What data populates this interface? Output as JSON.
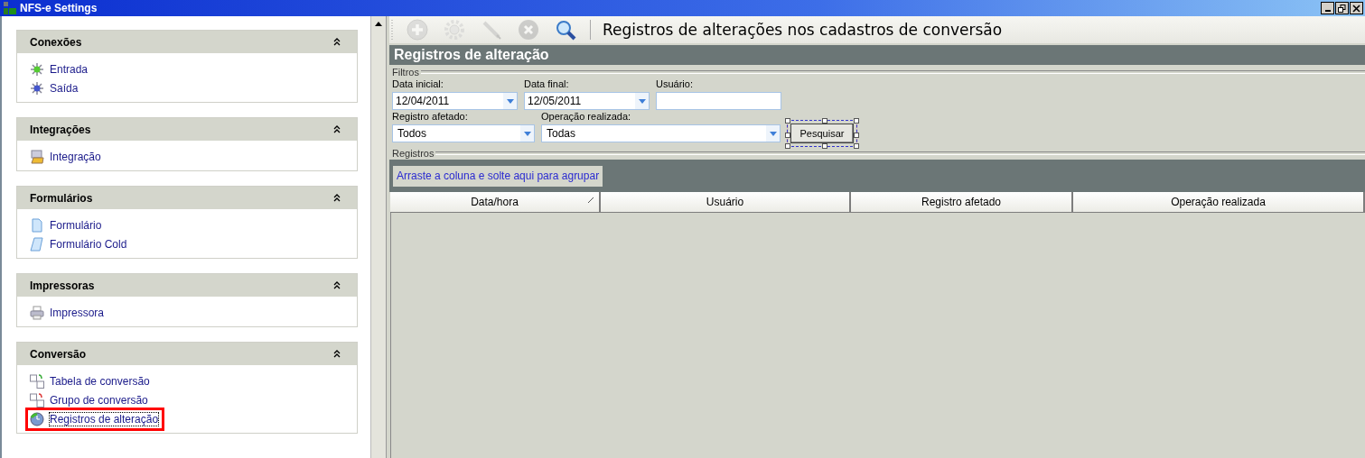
{
  "window": {
    "title": "NFS-e Settings"
  },
  "sidebar": {
    "sections": [
      {
        "title": "Conexões",
        "expanded": true,
        "items": [
          {
            "label": "Entrada",
            "kind": "in",
            "selected": false
          },
          {
            "label": "Saída",
            "kind": "out",
            "selected": false
          }
        ]
      },
      {
        "title": "Integrações",
        "expanded": true,
        "items": [
          {
            "label": "Integração",
            "kind": "integration",
            "selected": false
          }
        ]
      },
      {
        "title": "Formulários",
        "expanded": true,
        "items": [
          {
            "label": "Formulário",
            "kind": "form",
            "selected": false
          },
          {
            "label": "Formulário Cold",
            "kind": "cold",
            "selected": false
          }
        ]
      },
      {
        "title": "Impressoras",
        "expanded": true,
        "items": [
          {
            "label": "Impressora",
            "kind": "printer",
            "selected": false
          }
        ]
      },
      {
        "title": "Conversão",
        "expanded": true,
        "items": [
          {
            "label": "Tabela de conversão",
            "kind": "table",
            "selected": false
          },
          {
            "label": "Grupo de conversão",
            "kind": "group",
            "selected": false
          },
          {
            "label": "Registros de alteração",
            "kind": "log",
            "selected": true
          }
        ]
      }
    ]
  },
  "toolbar": {
    "buttons": [
      {
        "kind": "add",
        "disabled": true
      },
      {
        "kind": "gear",
        "disabled": true
      },
      {
        "kind": "edit",
        "disabled": true
      },
      {
        "kind": "delete",
        "disabled": true
      },
      {
        "kind": "search",
        "disabled": false
      }
    ],
    "title": "Registros de alterações nos cadastros de conversão"
  },
  "panel": {
    "title": "Registros de alteração",
    "filters": {
      "legend": "Filtros",
      "rows": [
        [
          {
            "label": "Data inicial:",
            "value": "12/04/2011",
            "kind": "combo"
          },
          {
            "label": "Data final:",
            "value": "12/05/2011",
            "kind": "combo"
          },
          {
            "label": "Usuário:",
            "kind": "text"
          }
        ],
        [
          {
            "label": "Registro afetado:",
            "value": "Todos",
            "kind": "combo"
          },
          {
            "label": "Operação realizada:",
            "value": "Todas",
            "kind": "combo"
          }
        ]
      ],
      "button": {
        "label": "Pesquisar",
        "selected": true
      }
    },
    "records": {
      "legend": "Registros",
      "group_hint": "Arraste a coluna e solte aqui para agrupar",
      "columns": [
        {
          "label": "Data/hora",
          "sorted": true
        },
        {
          "label": "Usuário",
          "sorted": false
        },
        {
          "label": "Registro afetado",
          "sorted": false
        },
        {
          "label": "Operação realizada",
          "sorted": false
        }
      ]
    }
  }
}
